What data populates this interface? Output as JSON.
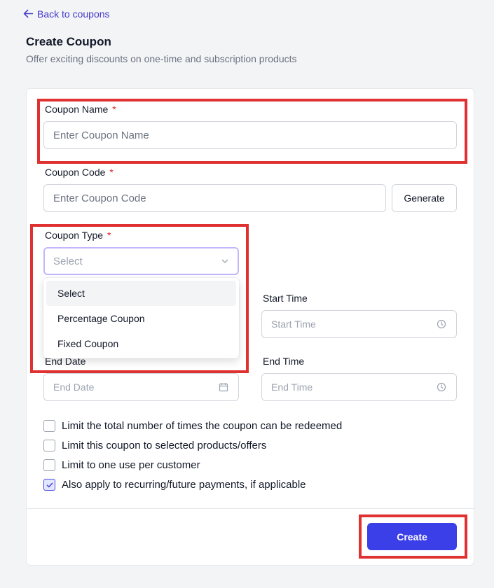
{
  "nav": {
    "back_label": "Back to coupons"
  },
  "header": {
    "title": "Create Coupon",
    "subtitle": "Offer exciting discounts on one-time and subscription products"
  },
  "form": {
    "coupon_name": {
      "label": "Coupon Name",
      "required": "*",
      "placeholder": "Enter Coupon Name",
      "value": ""
    },
    "coupon_code": {
      "label": "Coupon Code",
      "required": "*",
      "placeholder": "Enter Coupon Code",
      "value": "",
      "generate_label": "Generate"
    },
    "coupon_type": {
      "label": "Coupon Type",
      "required": "*",
      "selected": "Select",
      "options": [
        "Select",
        "Percentage Coupon",
        "Fixed Coupon"
      ]
    },
    "start_time": {
      "label": "Start Time",
      "placeholder": "Start Time"
    },
    "end_date": {
      "label": "End Date",
      "placeholder": "End Date"
    },
    "end_time": {
      "label": "End Time",
      "placeholder": "End Time"
    },
    "options": [
      {
        "label": "Limit the total number of times the coupon can be redeemed",
        "checked": false
      },
      {
        "label": "Limit this coupon to selected products/offers",
        "checked": false
      },
      {
        "label": "Limit to one use per customer",
        "checked": false
      },
      {
        "label": "Also apply to recurring/future payments, if applicable",
        "checked": true
      }
    ]
  },
  "footer": {
    "create_label": "Create"
  },
  "colors": {
    "accent": "#3b3fe8",
    "link": "#4338ca",
    "highlight": "#e03131",
    "required": "#dc2626"
  },
  "icons": [
    "arrow-left-icon",
    "chevron-down-icon",
    "clock-icon",
    "calendar-icon",
    "check-icon"
  ]
}
